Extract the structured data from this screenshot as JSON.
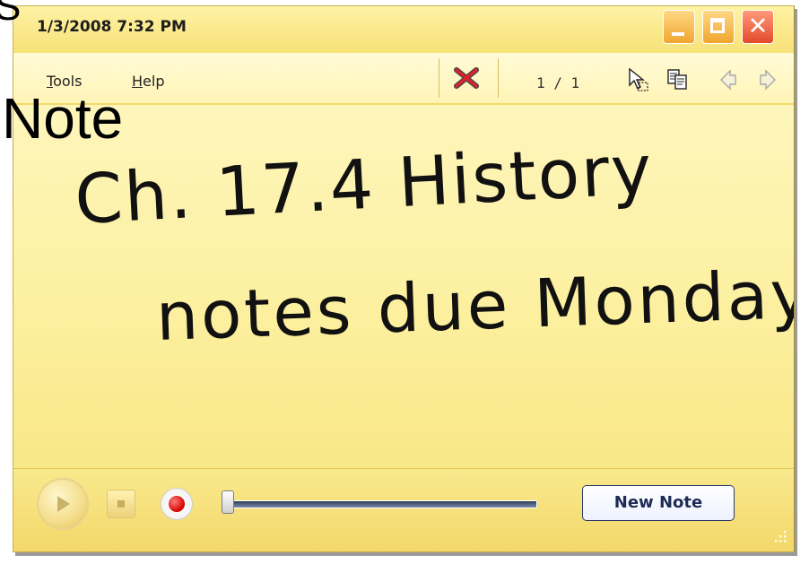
{
  "overlay": {
    "top_fragment": "S",
    "slide_word": "Note"
  },
  "window": {
    "title": "1/3/2008 7:32 PM",
    "controls": [
      "minimize",
      "maximize",
      "close"
    ]
  },
  "toolbar": {
    "menus": [
      "Tools",
      "Help"
    ],
    "page_indicator": "1 / 1",
    "icons": [
      "delete-note-icon",
      "select-icon",
      "copy-icon",
      "previous-note-icon",
      "next-note-icon"
    ]
  },
  "note": {
    "lines": [
      "Ch. 17.4 History",
      "notes due Monday"
    ]
  },
  "player": {
    "position_fraction": 0.0,
    "new_note_label": "New Note"
  },
  "colors": {
    "note_bg": "#fcf0a0",
    "titlebar": "#f7e178",
    "close_red": "#e2492a",
    "ink": "#111111"
  }
}
